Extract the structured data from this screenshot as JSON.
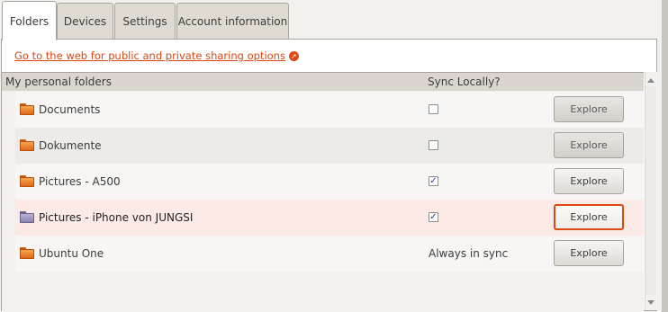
{
  "tabs": [
    {
      "label": "Folders",
      "active": true
    },
    {
      "label": "Devices",
      "active": false
    },
    {
      "label": "Settings",
      "active": false
    },
    {
      "label": "Account information",
      "active": false
    }
  ],
  "web_link": {
    "label": "Go to the web for public and private sharing options",
    "icon": "external-link-icon"
  },
  "list": {
    "col_name": "My personal folders",
    "col_sync": "Sync Locally?",
    "rows": [
      {
        "name": "Documents",
        "sync": "unchecked",
        "button": "Explore",
        "state": "disabled"
      },
      {
        "name": "Dokumente",
        "sync": "unchecked",
        "button": "Explore",
        "state": "disabled"
      },
      {
        "name": "Pictures - A500",
        "sync": "checked",
        "button": "Explore",
        "state": "normal"
      },
      {
        "name": "Pictures - iPhone von JUNGSI",
        "sync": "checked",
        "button": "Explore",
        "state": "focused"
      },
      {
        "name": "Ubuntu One",
        "sync": "text",
        "sync_text": "Always in sync",
        "button": "Explore",
        "state": "normal"
      }
    ]
  },
  "colors": {
    "accent": "#dd4814",
    "header_bg": "#dad6cf",
    "selected_row": "#fbeae6"
  }
}
